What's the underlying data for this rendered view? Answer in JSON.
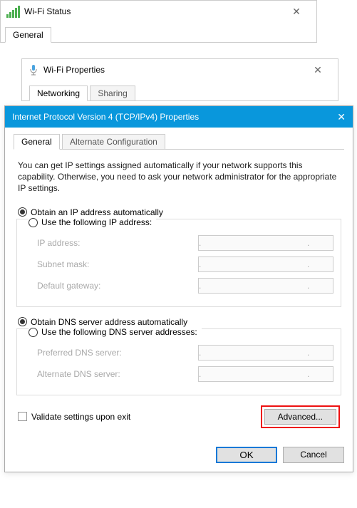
{
  "status_window": {
    "title": "Wi-Fi Status",
    "tab": "General"
  },
  "props_window": {
    "title": "Wi-Fi Properties",
    "tab_active": "Networking",
    "tab_inactive": "Sharing"
  },
  "ipv4": {
    "title": "Internet Protocol Version 4 (TCP/IPv4) Properties",
    "tab_active": "General",
    "tab_inactive": "Alternate Configuration",
    "description": "You can get IP settings assigned automatically if your network supports this capability. Otherwise, you need to ask your network administrator for the appropriate IP settings.",
    "ip": {
      "auto_label": "Obtain an IP address automatically",
      "manual_label": "Use the following IP address:",
      "ip_address_label": "IP address:",
      "subnet_label": "Subnet mask:",
      "gateway_label": "Default gateway:"
    },
    "dns": {
      "auto_label": "Obtain DNS server address automatically",
      "manual_label": "Use the following DNS server addresses:",
      "preferred_label": "Preferred DNS server:",
      "alternate_label": "Alternate DNS server:"
    },
    "validate_label": "Validate settings upon exit",
    "advanced_label": "Advanced...",
    "ok_label": "OK",
    "cancel_label": "Cancel",
    "dots": ".     .     ."
  }
}
